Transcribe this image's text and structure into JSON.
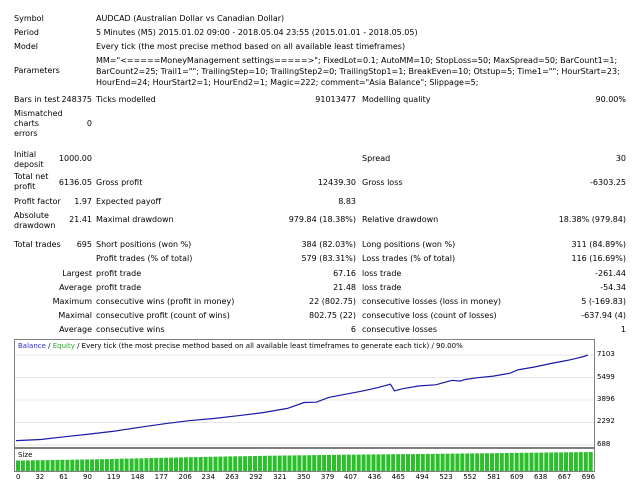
{
  "report": {
    "symbol": {
      "label": "Symbol",
      "value": "AUDCAD (Australian Dollar vs Canadian Dollar)"
    },
    "period": {
      "label": "Period",
      "value": "5 Minutes (M5) 2015.01.02 09:00 - 2018.05.04 23:55 (2015.01.01 - 2018.05.05)"
    },
    "model": {
      "label": "Model",
      "value": "Every tick (the most precise method based on all available least timeframes)"
    },
    "parameters": {
      "label": "Parameters",
      "value": "MM=\"<=====MoneyManagement settings=====>\"; FixedLot=0.1; AutoMM=10; StopLoss=50; MaxSpread=50; BarCount1=1; BarCount2=25; Trail1=\"\"; TrailingStep=10; TrailingStep2=0; TrailingStop1=1; BreakEven=10; Otstup=5; Time1=\"\"; HourStart=23; HourEnd=24; HourStart2=1; HourEnd2=1; Magic=222; comment=\"Asia Balance\"; Slippage=5;"
    },
    "bars_in_test": {
      "label": "Bars in test",
      "value": "248375"
    },
    "ticks_modelled": {
      "label": "Ticks modelled",
      "value": "91013477"
    },
    "modelling_quality": {
      "label": "Modelling quality",
      "value": "90.00%"
    },
    "mismatched": {
      "label": "Mismatched charts errors",
      "value": "0"
    },
    "initial_deposit": {
      "label": "Initial deposit",
      "value": "1000.00"
    },
    "spread": {
      "label": "Spread",
      "value": "30"
    },
    "total_net_profit": {
      "label": "Total net profit",
      "value": "6136.05"
    },
    "gross_profit": {
      "label": "Gross profit",
      "value": "12439.30"
    },
    "gross_loss": {
      "label": "Gross loss",
      "value": "-6303.25"
    },
    "profit_factor": {
      "label": "Profit factor",
      "value": "1.97"
    },
    "expected_payoff": {
      "label": "Expected payoff",
      "value": "8.83"
    },
    "absolute_drawdown": {
      "label": "Absolute drawdown",
      "value": "21.41"
    },
    "maximal_drawdown": {
      "label": "Maximal drawdown",
      "value": "979.84 (18.38%)"
    },
    "relative_drawdown": {
      "label": "Relative drawdown",
      "value": "18.38% (979.84)"
    },
    "total_trades": {
      "label": "Total trades",
      "value": "695"
    },
    "short_positions": {
      "label": "Short positions (won %)",
      "value": "384 (82.03%)"
    },
    "long_positions": {
      "label": "Long positions (won %)",
      "value": "311 (84.89%)"
    },
    "profit_trades": {
      "label": "Profit trades (% of total)",
      "value": "579 (83.31%)"
    },
    "loss_trades": {
      "label": "Loss trades (% of total)",
      "value": "116 (16.69%)"
    },
    "largest": {
      "label": "Largest",
      "profit_label": "profit trade",
      "profit_value": "67.16",
      "loss_label": "loss trade",
      "loss_value": "-261.44"
    },
    "average": {
      "label": "Average",
      "profit_label": "profit trade",
      "profit_value": "21.48",
      "loss_label": "loss trade",
      "loss_value": "-54.34"
    },
    "maximum": {
      "label": "Maximum",
      "wins_label": "consecutive wins (profit in money)",
      "wins_value": "22 (802.75)",
      "losses_label": "consecutive losses (loss in money)",
      "losses_value": "5 (-169.83)"
    },
    "maximal": {
      "label": "Maximal",
      "profit_label": "consecutive profit (count of wins)",
      "profit_value": "802.75 (22)",
      "loss_label": "consecutive loss (count of losses)",
      "loss_value": "-637.94 (4)"
    },
    "average_consec": {
      "label": "Average",
      "wins_label": "consecutive wins",
      "wins_value": "6",
      "losses_label": "consecutive losses",
      "losses_value": "1"
    }
  },
  "chart_data": {
    "type": "line",
    "legend_balance": "Balance",
    "legend_sep": " / ",
    "legend_equity": "Equity",
    "legend_rest": " / Every tick (the most precise method based on all available least timeframes to generate each tick) / 90.00%",
    "size_label": "Size",
    "y_ticks": [
      "7103",
      "5499",
      "3896",
      "2292",
      "688"
    ],
    "y_values": [
      7103,
      5499,
      3896,
      2292,
      688
    ],
    "x_ticks": [
      "0",
      "32",
      "61",
      "90",
      "119",
      "148",
      "177",
      "206",
      "234",
      "263",
      "292",
      "321",
      "350",
      "379",
      "407",
      "436",
      "465",
      "494",
      "523",
      "552",
      "581",
      "609",
      "638",
      "667",
      "696"
    ],
    "x_values": [
      0,
      32,
      61,
      90,
      119,
      148,
      177,
      206,
      234,
      263,
      292,
      321,
      350,
      379,
      407,
      436,
      465,
      494,
      523,
      552,
      581,
      609,
      638,
      667,
      696
    ],
    "ylim": [
      688,
      7460
    ],
    "xlim": [
      0,
      700
    ],
    "colors": {
      "balance": "#1a1aa8",
      "equity": "#27a827",
      "size": "#2bbf2b"
    },
    "series": [
      {
        "name": "Balance",
        "x": [
          0,
          30,
          60,
          90,
          120,
          150,
          180,
          210,
          240,
          270,
          300,
          330,
          350,
          365,
          380,
          400,
          420,
          440,
          455,
          460,
          470,
          490,
          510,
          530,
          540,
          545,
          560,
          580,
          600,
          610,
          615,
          630,
          650,
          670,
          680,
          690,
          695
        ],
        "y": [
          1000,
          1080,
          1280,
          1470,
          1680,
          1950,
          2200,
          2420,
          2580,
          2780,
          3000,
          3300,
          3720,
          3740,
          4080,
          4300,
          4520,
          4780,
          5020,
          4550,
          4700,
          4900,
          4980,
          5300,
          5240,
          5350,
          5480,
          5600,
          5800,
          6050,
          6100,
          6250,
          6500,
          6720,
          6850,
          7000,
          7103
        ]
      }
    ],
    "size_bars": [
      {
        "x": 0,
        "y": 0.55
      },
      {
        "x": 100,
        "y": 0.62
      },
      {
        "x": 200,
        "y": 0.72
      },
      {
        "x": 300,
        "y": 0.8
      },
      {
        "x": 400,
        "y": 0.86
      },
      {
        "x": 500,
        "y": 0.9
      },
      {
        "x": 600,
        "y": 0.95
      },
      {
        "x": 696,
        "y": 1.0
      }
    ]
  }
}
